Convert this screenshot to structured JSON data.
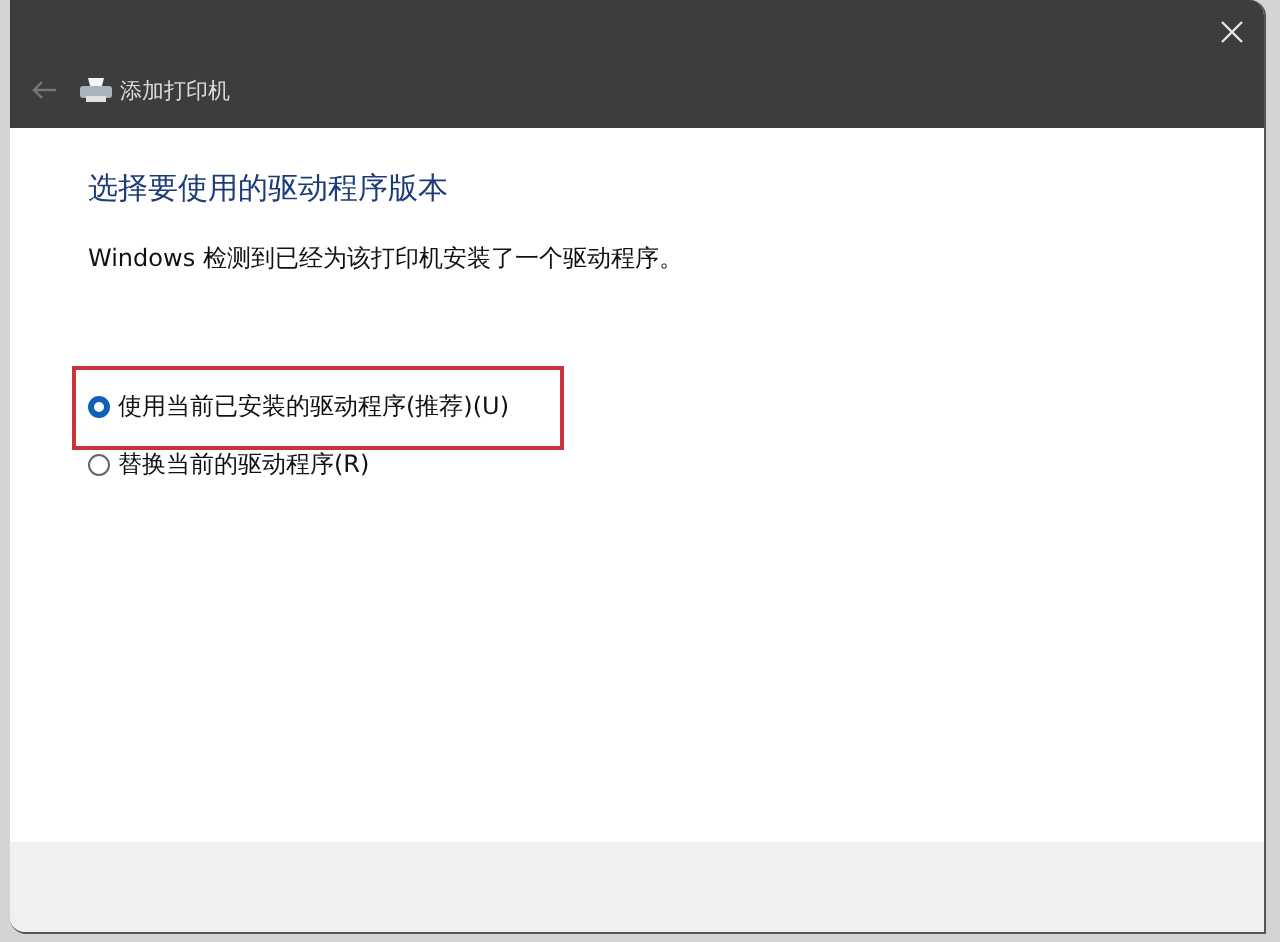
{
  "window": {
    "title": "添加打印机"
  },
  "heading": "选择要使用的驱动程序版本",
  "description": "Windows 检测到已经为该打印机安装了一个驱动程序。",
  "options": [
    {
      "label": "使用当前已安装的驱动程序(推荐)(U)",
      "selected": true,
      "highlighted": true
    },
    {
      "label": "替换当前的驱动程序(R)",
      "selected": false,
      "highlighted": false
    }
  ]
}
